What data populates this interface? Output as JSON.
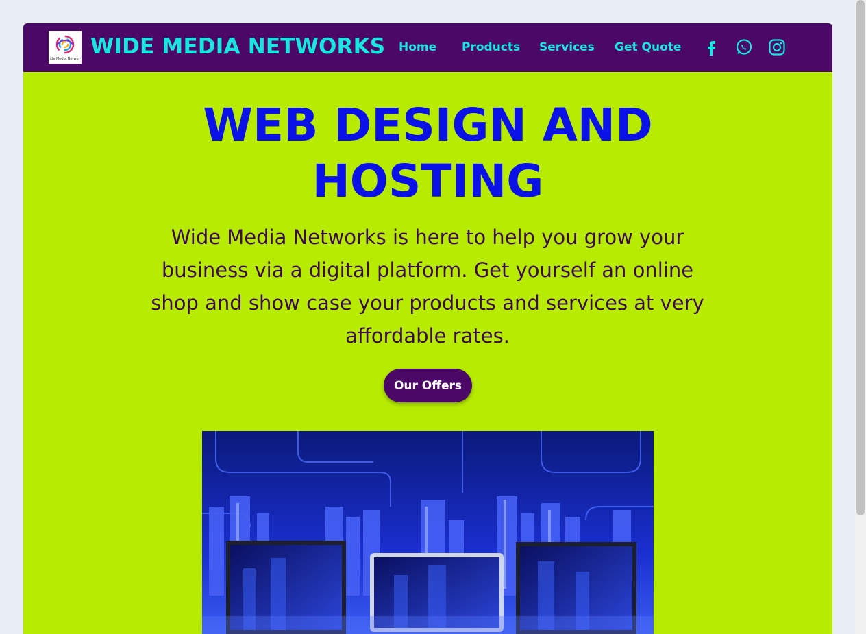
{
  "brand": {
    "name": "WIDE MEDIA NETWORKS",
    "logo_text": "Wide Media Networks"
  },
  "nav": {
    "items": [
      {
        "label": "Home"
      },
      {
        "label": "Products"
      },
      {
        "label": "Services"
      },
      {
        "label": "Get Quote"
      }
    ],
    "social": [
      "facebook-icon",
      "whatsapp-icon",
      "instagram-icon"
    ]
  },
  "hero": {
    "title_line1": "WEB DESIGN AND",
    "title_line2": "HOSTING",
    "description": "Wide Media Networks is here to help you grow your business via a digital platform. Get yourself an online shop and show case your products and services at very affordable rates.",
    "button_label": "Our Offers"
  },
  "colors": {
    "navbar": "#4b0866",
    "accent": "#19e6e0",
    "hero_background": "#b7ec02",
    "title": "#0b12e8",
    "body_text": "#3c0a4e"
  }
}
